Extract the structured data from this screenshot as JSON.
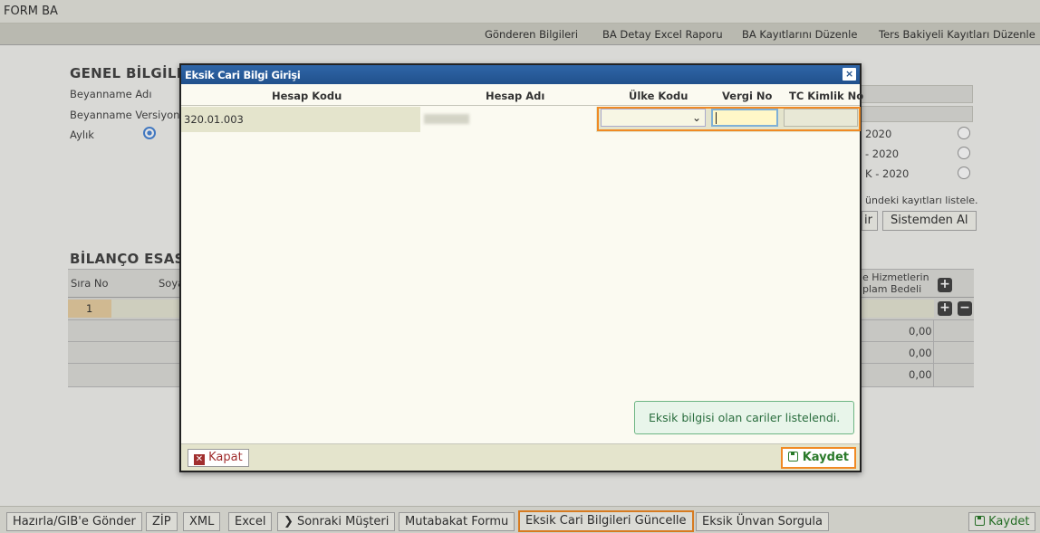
{
  "title": "FORM BA",
  "menu": [
    "Gönderen Bilgileri",
    "BA Detay Excel Raporu",
    "BA Kayıtlarını Düzenle",
    "Ters Bakiyeli Kayıtları Düzenle"
  ],
  "genel": {
    "title": "GENEL BİLGİLER",
    "beyanname_adi": "Beyanname Adı",
    "beyanname_versiyonu": "Beyanname Versiyonu",
    "aylik": "Aylık",
    "period_opts": [
      "2020",
      "- 2020",
      "K - 2020"
    ],
    "info_text": "ündeki kayıtları listele.",
    "getir_label": "ir",
    "sistemden_al": "Sistemden Al"
  },
  "bilanco": {
    "title": "BİLANÇO ESASIN",
    "sira_no": "Sıra No",
    "soyad": "Soya",
    "hizmet_hdr_1": "e Hizmetlerin",
    "hizmet_hdr_2": "plam Bedeli",
    "row_no": "1",
    "totals": [
      "0,00",
      "0,00",
      "0,00"
    ]
  },
  "modal": {
    "title": "Eksik Cari Bilgi Girişi",
    "close_glyph": "×",
    "columns": [
      "Hesap Kodu",
      "Hesap Adı",
      "Ülke Kodu",
      "Vergi No",
      "TC Kimlik No"
    ],
    "rows": [
      {
        "hesap_kodu": "320.01.003",
        "hesap_adi": "",
        "ulke_kodu": "",
        "vergi_no": "",
        "tc_kimlik_no": ""
      }
    ],
    "toast": "Eksik bilgisi olan cariler listelendi.",
    "kapat_label": "Kapat",
    "kaydet_label": "Kaydet"
  },
  "bottom": {
    "buttons": [
      "Hazırla/GIB'e Gönder",
      "ZİP",
      "XML",
      "Excel",
      "Sonraki Müşteri",
      "Mutabakat Formu",
      "Eksik Cari Bilgileri Güncelle",
      "Eksik Ünvan Sorgula"
    ],
    "kaydet_label": "Kaydet"
  },
  "colors": {
    "accent_orange": "#f08a24",
    "modal_header_blue": "#21518c",
    "success_green": "#2a7a2a",
    "danger_red": "#a12f2f"
  }
}
